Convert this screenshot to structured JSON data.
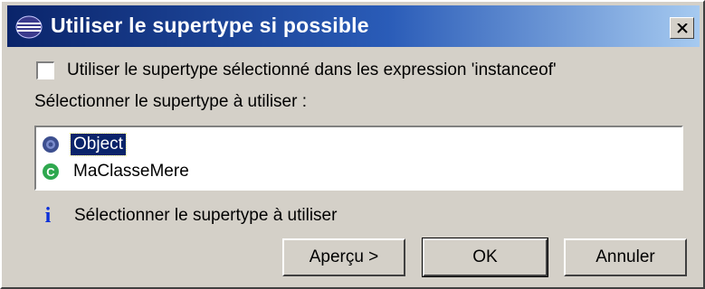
{
  "window": {
    "title": "Utiliser le supertype si possible",
    "title_gradient": [
      "#0a246a",
      "#a6caf0"
    ]
  },
  "options": {
    "instanceof_checkbox_label": "Utiliser le supertype sélectionné dans les expression 'instanceof'",
    "instanceof_checked": false
  },
  "supertype": {
    "section_label": "Sélectionner le supertype à utiliser :",
    "items": [
      {
        "label": "Object",
        "icon": "interface-icon",
        "selected": true
      },
      {
        "label": "MaClasseMere",
        "icon": "class-icon",
        "selected": false
      }
    ]
  },
  "status": {
    "icon": "info-icon",
    "message": "Sélectionner le supertype à utiliser"
  },
  "buttons": {
    "preview": "Aperçu >",
    "ok": "OK",
    "cancel": "Annuler"
  },
  "colors": {
    "selection_bg": "#0a246a",
    "info_blue": "#0b2fd9",
    "class_green": "#2fa84f"
  }
}
